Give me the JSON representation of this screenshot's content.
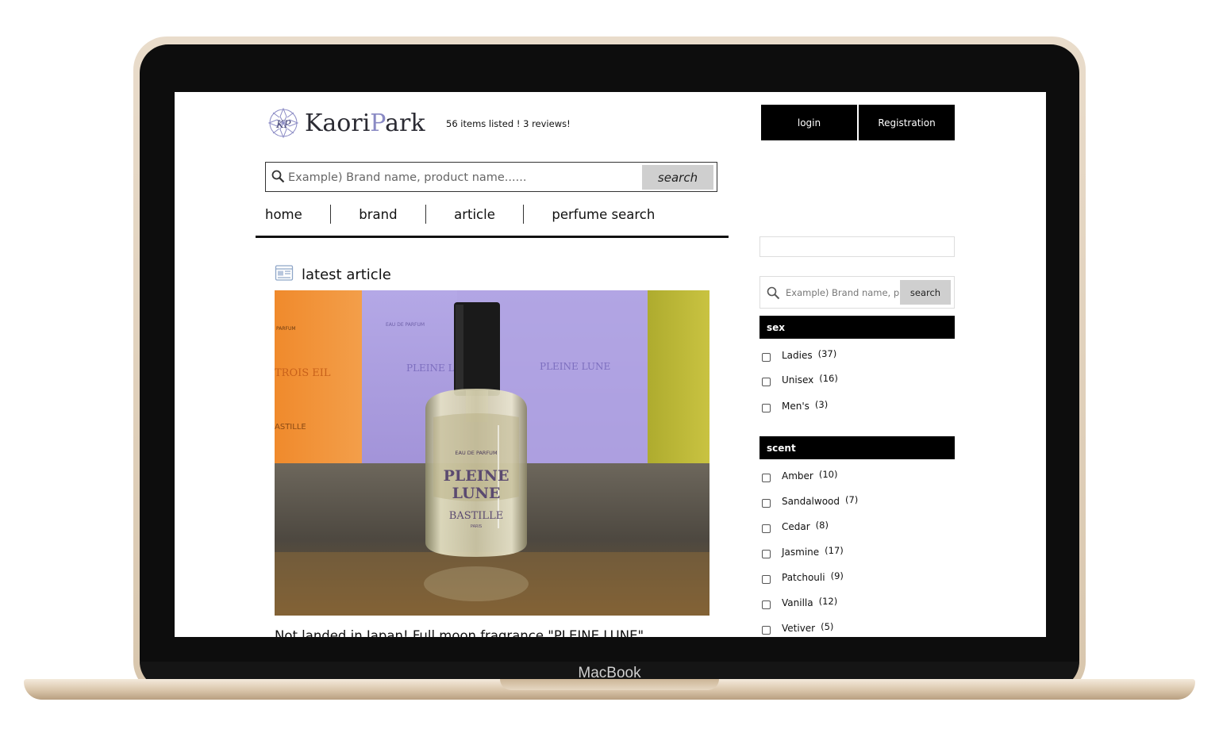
{
  "device": {
    "label": "MacBook"
  },
  "site": {
    "logo_part1": "Kaori",
    "logo_part2": "P",
    "logo_part3": "ark",
    "count_text": "56 items listed ! 3 reviews!"
  },
  "auth": {
    "login_label": "login",
    "register_label": "Registration"
  },
  "search": {
    "placeholder": "Example) Brand name, product name......",
    "button_label": "search"
  },
  "nav": {
    "items": [
      "home",
      "brand",
      "article",
      "perfume search"
    ]
  },
  "main": {
    "section_title": "latest article",
    "article_title": "Not landed in Japan! Full moon fragrance \"PLEINE LUNE\"",
    "image_text": {
      "left_box_top": "PARFUM",
      "left_box_name": "TROIS\nEIL",
      "left_box_brand": "ASTILLE",
      "center_box_name_1": "PLEINE\nLUNE",
      "center_box_name_2": "PLEINE\nLUNE",
      "center_box_top": "EAU DE PARFUM",
      "bottle_top": "EAU DE PARFUM",
      "bottle_name_1": "PLEINE",
      "bottle_name_2": "LUNE",
      "bottle_brand": "BASTILLE",
      "bottle_city": "PARIS"
    }
  },
  "sidebar": {
    "search_placeholder": "Example) Brand name, product name......",
    "search_button": "search",
    "sex_title": "sex",
    "sex": [
      {
        "label": "Ladies",
        "count": "(37)"
      },
      {
        "label": "Unisex",
        "count": "(16)"
      },
      {
        "label": "Men's",
        "count": "(3)"
      }
    ],
    "scent_title": "scent",
    "scent": [
      {
        "label": "Amber",
        "count": "(10)"
      },
      {
        "label": "Sandalwood",
        "count": "(7)"
      },
      {
        "label": "Cedar",
        "count": "(8)"
      },
      {
        "label": "Jasmine",
        "count": "(17)"
      },
      {
        "label": "Patchouli",
        "count": "(9)"
      },
      {
        "label": "Vanilla",
        "count": "(12)"
      },
      {
        "label": "Vetiver",
        "count": "(5)"
      }
    ]
  },
  "colors": {
    "frame_gold": "#d8c6ad",
    "bezel": "#0d0d0d",
    "logo_accent": "#8a8ac4",
    "button_black": "#000000",
    "search_button_gray": "#cfcfcf"
  }
}
